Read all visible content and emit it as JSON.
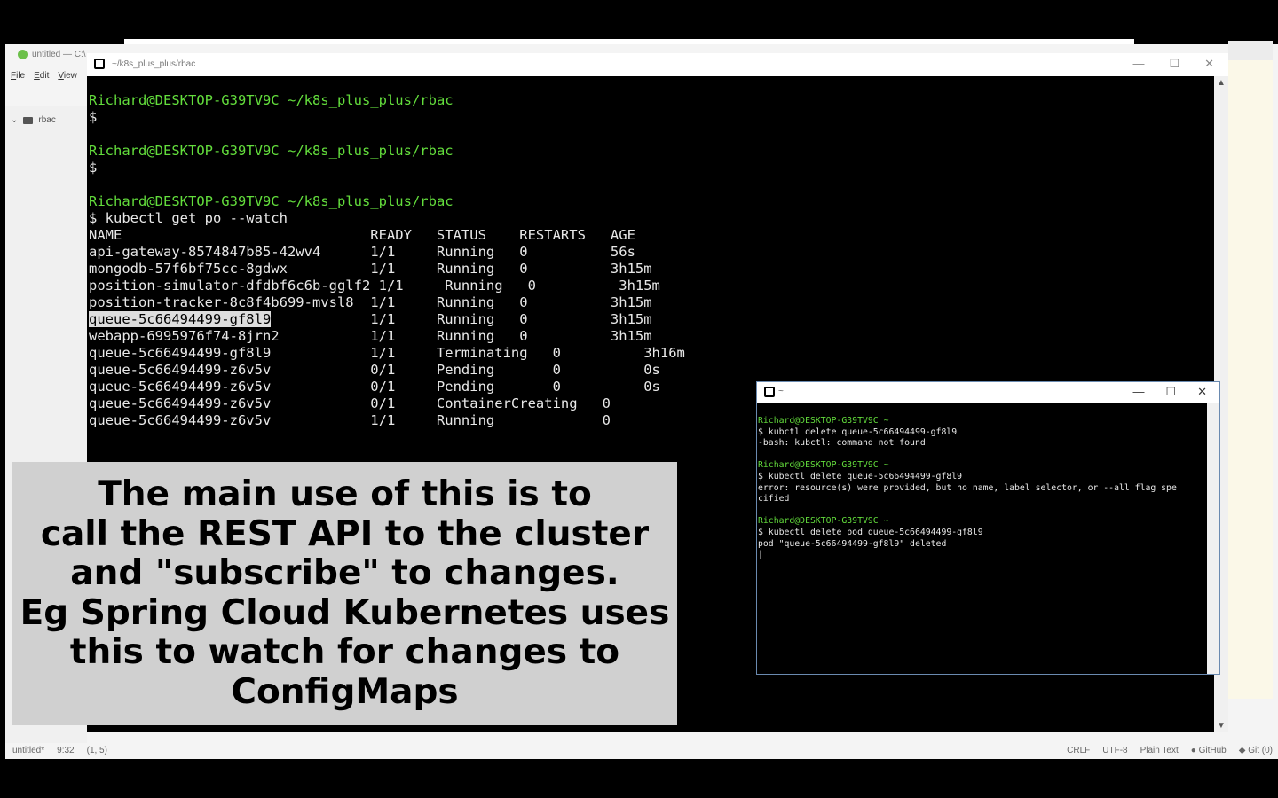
{
  "editor": {
    "title": "untitled — C:\\",
    "menu": [
      "File",
      "Edit",
      "View"
    ],
    "tree_folder": "rbac",
    "status_left": [
      "untitled*",
      "9:32",
      "(1, 5)"
    ],
    "status_right": [
      "CRLF",
      "UTF-8",
      "Plain Text",
      "GitHub",
      "Git (0)"
    ]
  },
  "terminal": {
    "title": "~/k8s_plus_plus/rbac",
    "prompt_user": "Richard@DESKTOP-G39TV9C",
    "prompt_path": "~/k8s_plus_plus/rbac",
    "prompt_symbol": "$",
    "command": "$ kubectl get po --watch",
    "header": "NAME                              READY   STATUS    RESTARTS   AGE",
    "rows": [
      "api-gateway-8574847b85-42wv4      1/1     Running   0          56s",
      "mongodb-57f6bf75cc-8gdwx          1/1     Running   0          3h15m",
      "position-simulator-dfdbf6c6b-gglf2 1/1     Running   0          3h15m",
      "position-tracker-8c8f4b699-mvsl8  1/1     Running   0          3h15m",
      "queue-5c66494499-gf8l9",
      "                                  1/1     Running   0          3h15m",
      "webapp-6995976f74-8jrn2           1/1     Running   0          3h15m",
      "queue-5c66494499-gf8l9            1/1     Terminating   0          3h16m",
      "queue-5c66494499-z6v5v            0/1     Pending       0          0s",
      "queue-5c66494499-z6v5v            0/1     Pending       0          0s",
      "queue-5c66494499-z6v5v            0/1     ContainerCreating   0",
      "queue-5c66494499-z6v5v            1/1     Running             0"
    ]
  },
  "caption": {
    "lines": [
      "The main use of this is to",
      "call the REST API to the cluster",
      "and \"subscribe\" to changes.",
      "Eg Spring Cloud Kubernetes uses",
      "this to watch for changes to",
      "ConfigMaps"
    ]
  },
  "terminal2": {
    "title": "~",
    "prompt_user": "Richard@DESKTOP-G39TV9C",
    "prompt_path": "~",
    "cmd1": "$ kubctl delete queue-5c66494499-gf8l9",
    "out1": "-bash: kubctl: command not found",
    "cmd2": "$ kubectl delete queue-5c66494499-gf8l9",
    "out2a": "error: resource(s) were provided, but no name, label selector, or --all flag spe",
    "out2b": "cified",
    "cmd3": "$ kubectl delete pod queue-5c66494499-gf8l9",
    "out3": "pod \"queue-5c66494499-gf8l9\" deleted"
  },
  "window_controls": {
    "minimize": "—",
    "maximize": "☐",
    "close": "✕"
  }
}
